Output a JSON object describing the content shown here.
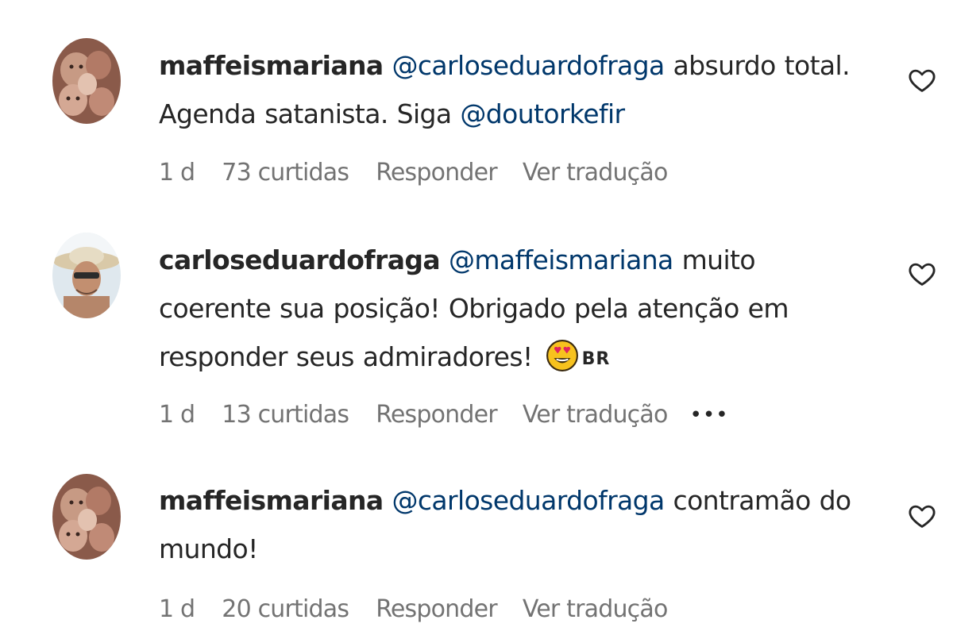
{
  "comments": [
    {
      "username": "maffeismariana",
      "mention": "@carloseduardofraga",
      "text_1": " absurdo total. Agenda satanista. Siga ",
      "mention_2": "@doutorkefir",
      "time": "1 d",
      "likes": "73 curtidas",
      "reply": "Responder",
      "translate": "Ver tradução",
      "avatar_icon": "profile-photo"
    },
    {
      "username": "carloseduardofraga",
      "mention": "@maffeismariana",
      "text_1": " muito coerente sua posição! Obrigado pela atenção em responder seus admiradores!",
      "emoji_icon": "heart-eyes-emoji",
      "flag": "BR",
      "time": "1 d",
      "likes": "13 curtidas",
      "reply": "Responder",
      "translate": "Ver tradução",
      "more": "•••",
      "avatar_icon": "profile-photo"
    },
    {
      "username": "maffeismariana",
      "mention": "@carloseduardofraga",
      "text_1": " contramão do mundo!",
      "time": "1 d",
      "likes": "20 curtidas",
      "reply": "Responder",
      "translate": "Ver tradução",
      "avatar_icon": "profile-photo"
    }
  ],
  "colors": {
    "text": "#262626",
    "mention": "#00376b",
    "meta": "#737373"
  }
}
